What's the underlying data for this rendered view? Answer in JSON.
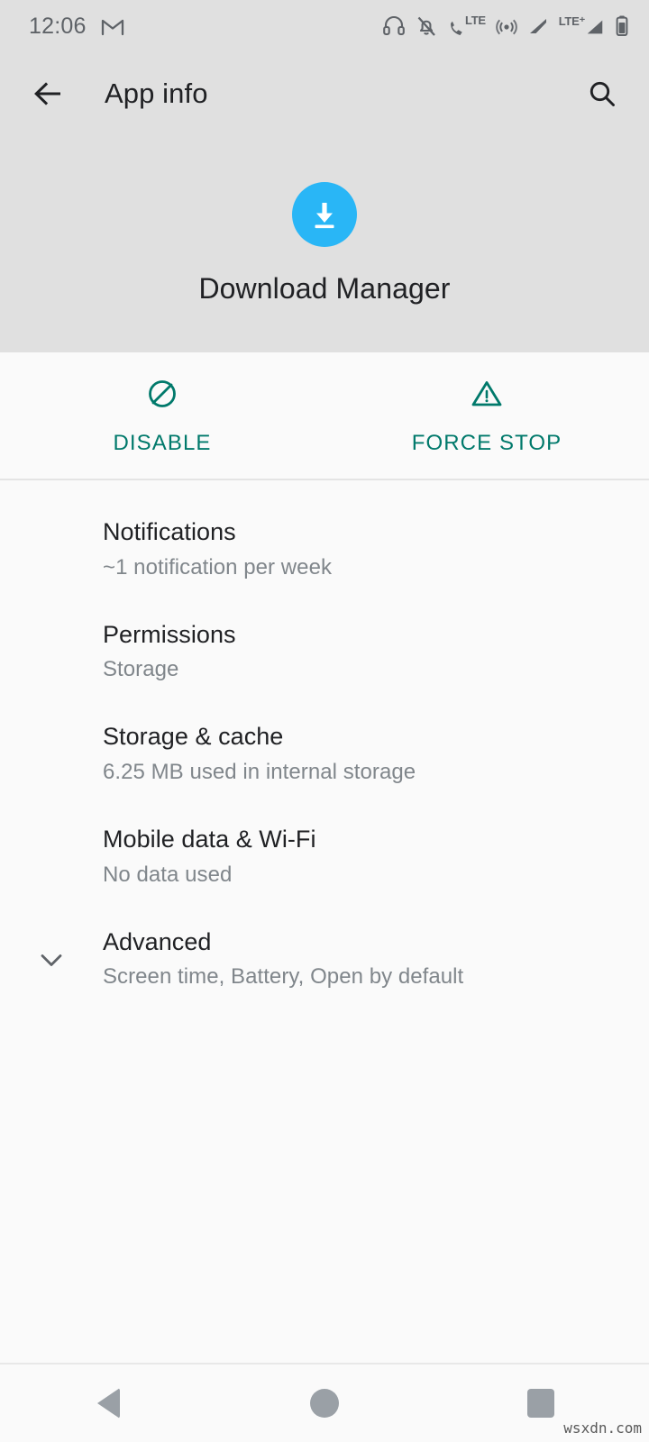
{
  "status_bar": {
    "clock": "12:06",
    "left_icons": [
      {
        "name": "gmail-icon",
        "label": "M"
      }
    ],
    "right_icons": [
      {
        "name": "headset-icon",
        "label": "headset"
      },
      {
        "name": "notifications-off-icon",
        "label": "notifications off"
      },
      {
        "name": "call-lte-icon",
        "label": "LTE"
      },
      {
        "name": "hotspot-icon",
        "label": "hotspot"
      },
      {
        "name": "signal-bars-icon",
        "label": "signal"
      },
      {
        "name": "signal-lte-plus-icon",
        "label": "LTE+"
      },
      {
        "name": "battery-icon",
        "label": "battery"
      }
    ],
    "text_color": "#5f6368",
    "background": "#e0e0e0"
  },
  "app_bar": {
    "back_label": "Back",
    "title": "App info",
    "search_label": "Search",
    "background": "#e0e0e0"
  },
  "app_header": {
    "app_name": "Download Manager",
    "icon_name": "download-manager-icon",
    "icon_color": "#29b6f6",
    "background": "#e0e0e0"
  },
  "actions": {
    "accent_color": "#00796b",
    "items": [
      {
        "id": "disable",
        "label": "DISABLE",
        "icon": "block-icon"
      },
      {
        "id": "force-stop",
        "label": "FORCE STOP",
        "icon": "warning-triangle-icon"
      }
    ]
  },
  "settings": {
    "items": [
      {
        "id": "notifications",
        "title": "Notifications",
        "subtitle": "~1 notification per week",
        "lead_icon": ""
      },
      {
        "id": "permissions",
        "title": "Permissions",
        "subtitle": "Storage",
        "lead_icon": ""
      },
      {
        "id": "storage-cache",
        "title": "Storage & cache",
        "subtitle": "6.25 MB used in internal storage",
        "lead_icon": ""
      },
      {
        "id": "mobile-data-wifi",
        "title": "Mobile data & Wi-Fi",
        "subtitle": "No data used",
        "lead_icon": ""
      },
      {
        "id": "advanced",
        "title": "Advanced",
        "subtitle": "Screen time, Battery, Open by default",
        "lead_icon": "chevron-down-icon"
      }
    ]
  },
  "nav_bar": {
    "buttons": [
      {
        "id": "back",
        "name": "nav-back-button"
      },
      {
        "id": "home",
        "name": "nav-home-button"
      },
      {
        "id": "recents",
        "name": "nav-recents-button"
      }
    ],
    "icon_color": "#9aa0a6"
  },
  "watermark": {
    "text": "wsxdn.com"
  }
}
